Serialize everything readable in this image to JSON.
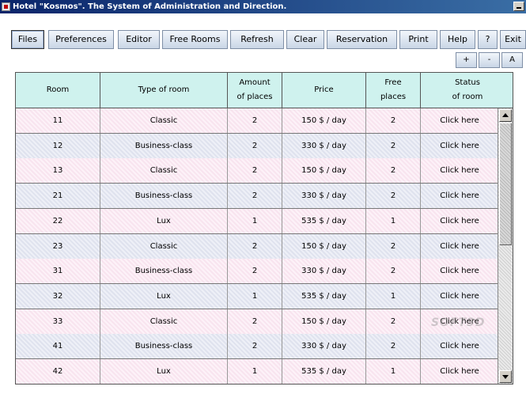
{
  "window": {
    "title": "Hotel \"Kosmos\". The System of Administration and Direction."
  },
  "toolbar": {
    "buttons": [
      "Files",
      "Preferences",
      "Editor",
      "Free Rooms",
      "Refresh",
      "Clear",
      "Reservation",
      "Print",
      "Help",
      "?",
      "Exit"
    ],
    "small_buttons": [
      "+",
      "-",
      "A"
    ]
  },
  "table": {
    "headers": [
      "Room",
      "Type of room",
      "Amount\nof places",
      "Price",
      "Free\nplaces",
      "Status\nof room"
    ],
    "rows": [
      [
        "11",
        "Classic",
        "2",
        "150 $ / day",
        "2",
        "Click here"
      ],
      [
        "12",
        "Business-class",
        "2",
        "330 $ / day",
        "2",
        "Click here"
      ],
      [
        "13",
        "Classic",
        "2",
        "150 $ / day",
        "2",
        "Click here"
      ],
      [
        "21",
        "Business-class",
        "2",
        "330 $ / day",
        "2",
        "Click here"
      ],
      [
        "22",
        "Lux",
        "1",
        "535 $ / day",
        "1",
        "Click here"
      ],
      [
        "23",
        "Classic",
        "2",
        "150 $ / day",
        "2",
        "Click here"
      ],
      [
        "31",
        "Business-class",
        "2",
        "330 $ / day",
        "2",
        "Click here"
      ],
      [
        "32",
        "Lux",
        "1",
        "535 $ / day",
        "1",
        "Click here"
      ],
      [
        "33",
        "Classic",
        "2",
        "150 $ / day",
        "2",
        "Click here"
      ],
      [
        "41",
        "Business-class",
        "2",
        "330 $ / day",
        "2",
        "Click here"
      ],
      [
        "42",
        "Lux",
        "1",
        "535 $ / day",
        "1",
        "Click here"
      ]
    ]
  },
  "watermark": "SOFT3D"
}
